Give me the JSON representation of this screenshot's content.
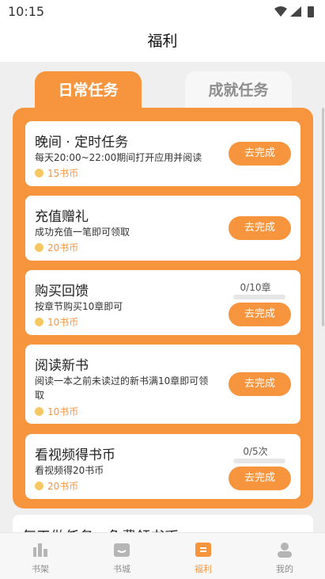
{
  "status_bar": {
    "time": "10:15"
  },
  "header": {
    "title": "福利"
  },
  "tabs": [
    {
      "label": "日常任务",
      "active": true
    },
    {
      "label": "成就任务",
      "active": false
    }
  ],
  "tasks": [
    {
      "title": "晚间 · 定时任务",
      "desc": "每天20:00~22:00期间打开应用并阅读",
      "reward": "15书币",
      "button": "去完成"
    },
    {
      "title": "充值赠礼",
      "desc": "成功充值一笔即可领取",
      "reward": "20书币",
      "button": "去完成"
    },
    {
      "title": "购买回馈",
      "desc": "按章节购买10章即可",
      "reward": "10书币",
      "button": "去完成",
      "progress": "0/10章",
      "progress_fraction": 0
    },
    {
      "title": "阅读新书",
      "desc": "阅读一本之前未读过的新书满10章即可领",
      "desc2": "取",
      "reward": "10书币",
      "button": "去完成"
    },
    {
      "title": "看视频得书币",
      "desc": "看视频得20书币",
      "reward": "20书币",
      "button": "去完成",
      "progress": "0/5次",
      "progress_fraction": 0
    }
  ],
  "footer": {
    "title": "每天做任务，免费领书币"
  },
  "bottom_nav": [
    {
      "label": "书架",
      "icon": "bookshelf-icon"
    },
    {
      "label": "书城",
      "icon": "bookstore-icon"
    },
    {
      "label": "福利",
      "icon": "welfare-icon",
      "active": true
    },
    {
      "label": "我的",
      "icon": "profile-icon"
    }
  ],
  "colors": {
    "accent": "#f7953f",
    "coin": "#f6c863",
    "inactive": "#8e8e8e"
  }
}
